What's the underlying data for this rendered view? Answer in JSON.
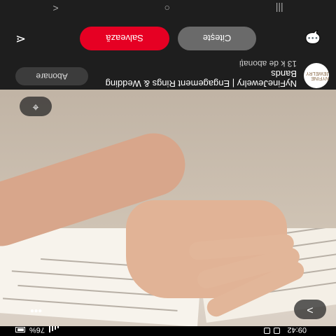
{
  "status": {
    "time": "09:42",
    "battery": "76%"
  },
  "pin": {
    "title": "NyFineJewelry | Engagement Rings & Wedding Bands",
    "subscribers": "13 k de abonați",
    "subscribe_label": "Abonare",
    "read_label": "Citește",
    "save_label": "Salvează",
    "avatar_text": "NYFINE JEWELRY",
    "more_label": "•••",
    "next_label": ">"
  },
  "nav": {
    "back": "<",
    "home": "○",
    "recent": "|||"
  }
}
